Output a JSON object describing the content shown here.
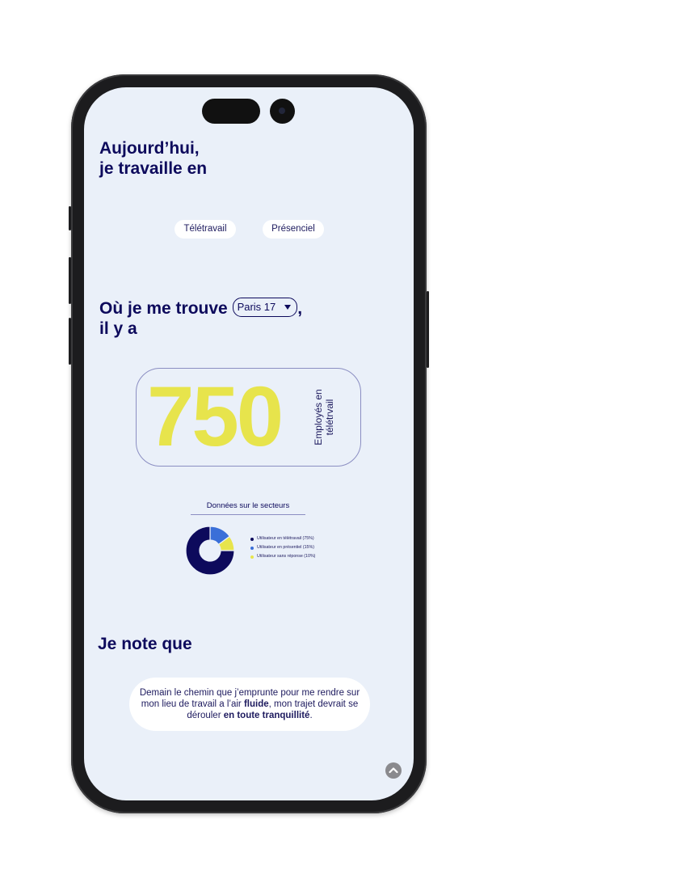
{
  "headline": {
    "line1": "Aujourd’hui,",
    "line2": "je travaille en"
  },
  "mode_options": [
    "Télétravail",
    "Présenciel"
  ],
  "location": {
    "prefix": "Où je me trouve",
    "suffix": ",",
    "selected": "Paris 17",
    "line2": "il y a"
  },
  "counter": {
    "value": "750",
    "label": "Employés en télétrvail"
  },
  "sector_data": {
    "title": "Données sur le secteurs",
    "legend": [
      {
        "label": "Utilisateur en télétravail (75%)",
        "color": "#0d0a5c"
      },
      {
        "label": "Utilisateur en présentiel (15%)",
        "color": "#3a6fd8"
      },
      {
        "label": "Utilisateur sans réponse (10%)",
        "color": "#e7e44c"
      }
    ]
  },
  "chart_data": {
    "type": "pie",
    "categories": [
      "Utilisateur en télétravail",
      "Utilisateur en présentiel",
      "Utilisateur sans réponse"
    ],
    "values": [
      75,
      15,
      10
    ],
    "title": "Données sur le secteurs"
  },
  "note": {
    "heading": "Je note que",
    "part1": "Demain le chemin que j’emprunte pour me rendre sur mon lieu de travail a l’air ",
    "bold1": "fluide",
    "part2": ", mon trajet devrait se dérouler ",
    "bold2": "en toute tranquillité",
    "part3": "."
  },
  "icons": {
    "scroll_top": "chevron-up-icon"
  }
}
